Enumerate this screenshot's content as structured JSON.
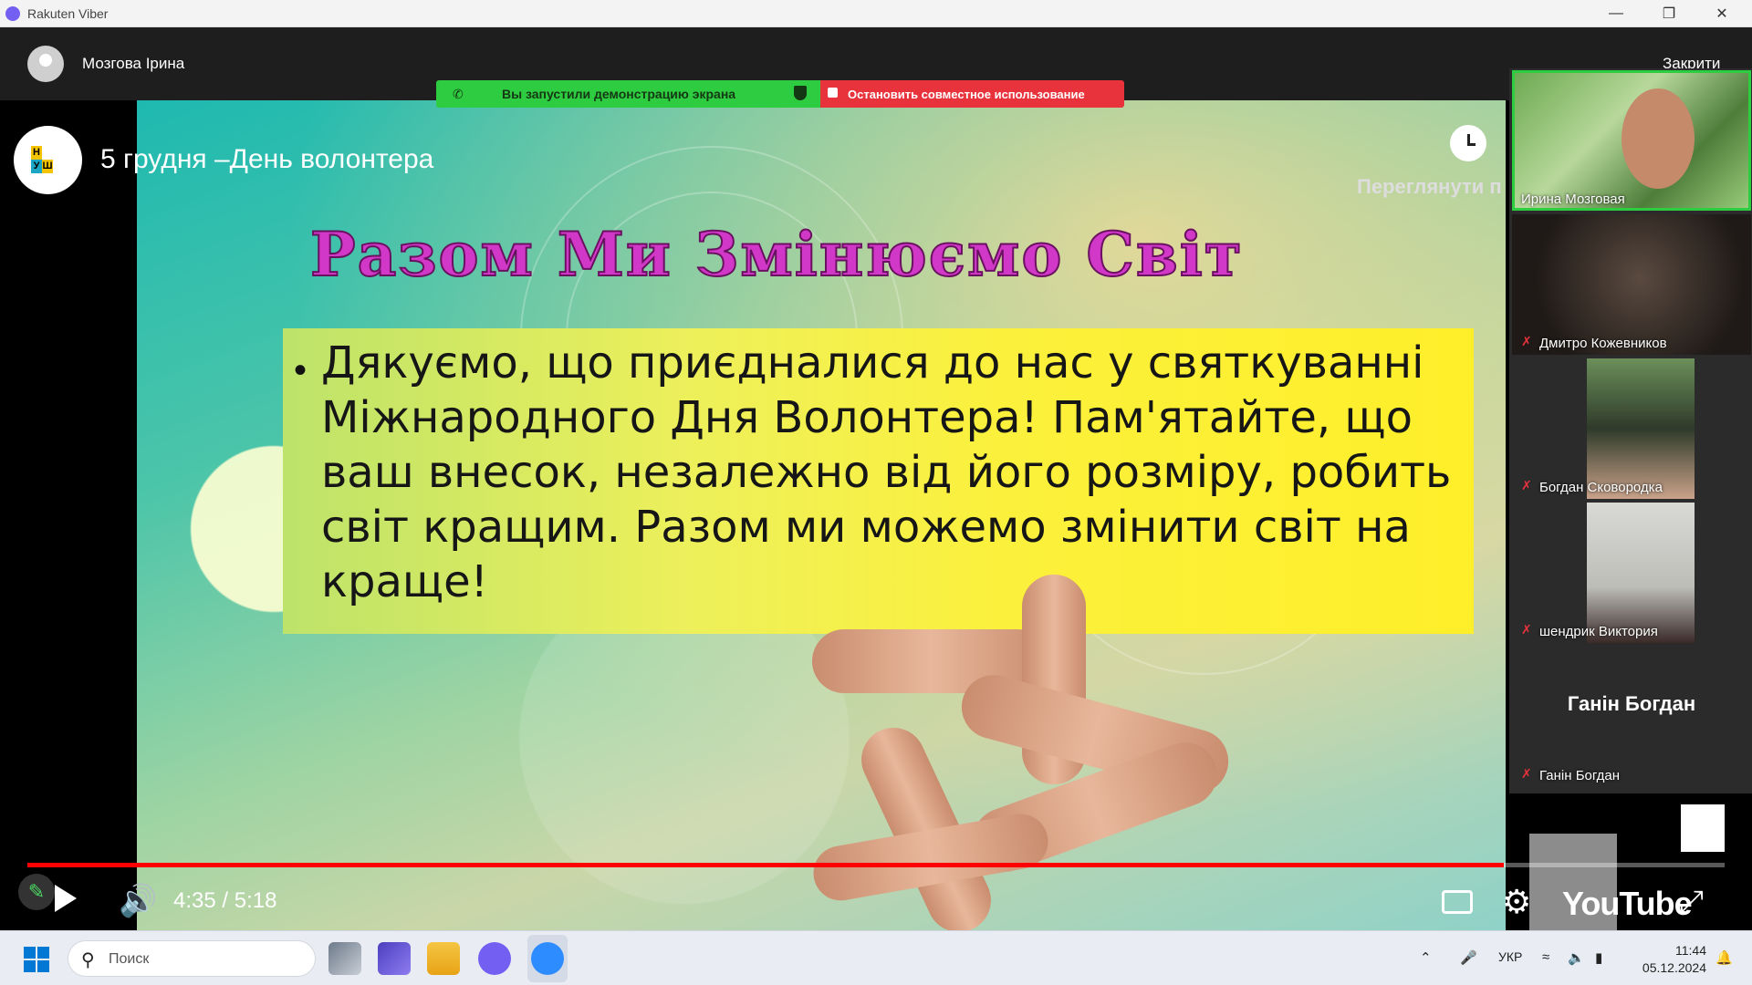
{
  "window": {
    "title": "Rakuten Viber",
    "minimize_icon": "minimize-icon",
    "restore_icon": "restore-icon",
    "close_icon": "close-icon"
  },
  "call": {
    "caller_name": "Мозгова Ірина",
    "close_label": "Закрити"
  },
  "share_banner": {
    "message": "Вы запустили демонстрацию экрана",
    "stop_label": "Остановить совместное использование",
    "colors": {
      "green": "#2ecc40",
      "red": "#e8323c"
    }
  },
  "video": {
    "title": "5 грудня –День волонтера",
    "watch_later_label": "Переглянути п",
    "time_display": "4:35 / 5:18",
    "progress": 0.87,
    "youtube_label": "YouTube",
    "channel_logo_letters": [
      "Н",
      "",
      "",
      "У",
      "Ш",
      ""
    ]
  },
  "slide": {
    "heading": "Разом Ми Змінюємо Світ",
    "bullet": "•",
    "body": "Дякуємо, що приєдналися до нас у святкуванні Міжнародного Дня Волонтера! Пам'ятайте, що ваш внесок, незалежно від його розміру, робить світ кращим. Разом ми можемо змінити світ на краще!"
  },
  "participants": [
    {
      "name": "Ирина Мозговая",
      "muted": false,
      "active": true
    },
    {
      "name": "Дмитро Кожевников",
      "muted": true,
      "active": false
    },
    {
      "name": "Богдан Сковородка",
      "muted": true,
      "active": false
    },
    {
      "name": "шендрик Виктория",
      "muted": true,
      "active": false
    },
    {
      "name": "Ганін Богдан",
      "muted": true,
      "active": false,
      "display_name": "Ганін Богдан"
    }
  ],
  "taskbar": {
    "search_placeholder": "Поиск",
    "language": "УКР",
    "time": "11:44",
    "date": "05.12.2024"
  }
}
